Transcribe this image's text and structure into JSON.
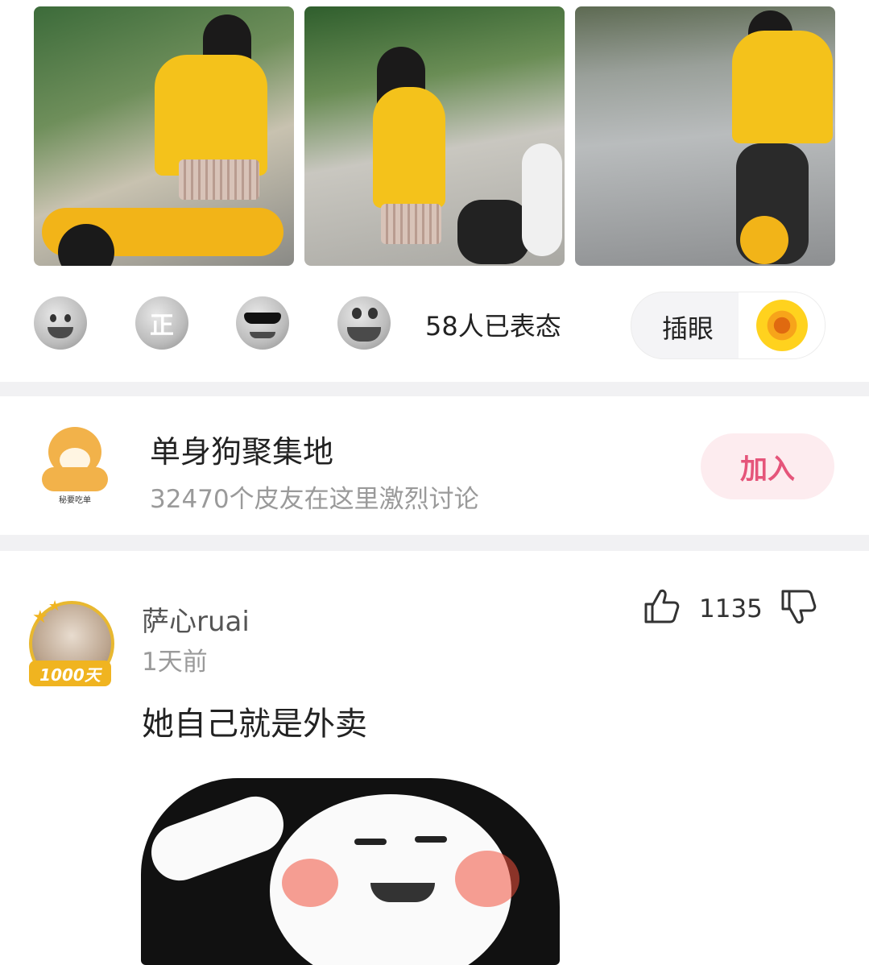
{
  "photos": [
    {
      "label": "photo-1"
    },
    {
      "label": "photo-2"
    },
    {
      "label": "photo-3"
    }
  ],
  "reactions": {
    "emojis": [
      "laugh-cry-icon",
      "zheng-icon",
      "sunglasses-icon",
      "grin-icon"
    ],
    "zheng_char": "正",
    "count_text": "58人已表态"
  },
  "chayan": {
    "label": "插眼"
  },
  "group": {
    "avatar_caption": "秘要吃单",
    "title": "单身狗聚集地",
    "subtitle": "32470个皮友在这里激烈讨论",
    "join_label": "加入"
  },
  "comment": {
    "user_name": "萨心ruai",
    "time": "1天前",
    "badge": "1000天",
    "text": "她自己就是外卖",
    "like_count": "1135"
  },
  "colors": {
    "accent_pink": "#e5557a",
    "join_bg": "#fdecef",
    "divider": "#f1f1f3",
    "badge_gold": "#f0b420"
  }
}
